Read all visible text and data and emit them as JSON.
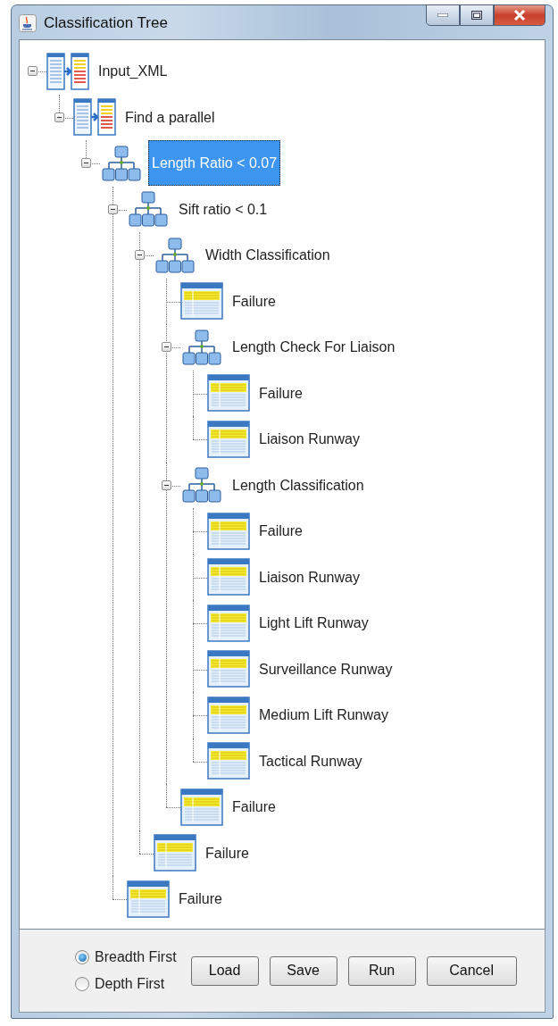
{
  "window": {
    "title": "Classification Tree"
  },
  "tree": [
    {
      "label": "Input_XML",
      "kind": "process",
      "expanded": true,
      "selected": false,
      "children": [
        {
          "label": "Find a parallel",
          "kind": "process",
          "expanded": true,
          "selected": false,
          "children": [
            {
              "label": "Length Ratio < 0.07",
              "kind": "split",
              "expanded": true,
              "selected": true,
              "children": [
                {
                  "label": "Sift ratio < 0.1",
                  "kind": "split",
                  "expanded": true,
                  "selected": false,
                  "children": [
                    {
                      "label": "Width Classification",
                      "kind": "split",
                      "expanded": true,
                      "selected": false,
                      "children": [
                        {
                          "label": "Failure",
                          "kind": "leaf",
                          "selected": false
                        },
                        {
                          "label": "Length Check For Liaison",
                          "kind": "split",
                          "expanded": true,
                          "selected": false,
                          "children": [
                            {
                              "label": "Failure",
                              "kind": "leaf",
                              "selected": false
                            },
                            {
                              "label": "Liaison Runway",
                              "kind": "leaf",
                              "selected": false
                            }
                          ]
                        },
                        {
                          "label": "Length Classification",
                          "kind": "split",
                          "expanded": true,
                          "selected": false,
                          "children": [
                            {
                              "label": "Failure",
                              "kind": "leaf",
                              "selected": false
                            },
                            {
                              "label": "Liaison Runway",
                              "kind": "leaf",
                              "selected": false
                            },
                            {
                              "label": "Light Lift Runway",
                              "kind": "leaf",
                              "selected": false
                            },
                            {
                              "label": "Surveillance Runway",
                              "kind": "leaf",
                              "selected": false
                            },
                            {
                              "label": "Medium Lift Runway",
                              "kind": "leaf",
                              "selected": false
                            },
                            {
                              "label": "Tactical Runway",
                              "kind": "leaf",
                              "selected": false
                            }
                          ]
                        },
                        {
                          "label": "Failure",
                          "kind": "leaf",
                          "selected": false
                        }
                      ]
                    },
                    {
                      "label": "Failure",
                      "kind": "leaf",
                      "selected": false
                    }
                  ]
                },
                {
                  "label": "Failure",
                  "kind": "leaf",
                  "selected": false
                }
              ]
            }
          ]
        }
      ]
    }
  ],
  "search_order": [
    {
      "label": "Breadth First",
      "selected": true
    },
    {
      "label": "Depth First",
      "selected": false
    }
  ],
  "buttons": [
    "Load",
    "Save",
    "Run",
    "Cancel"
  ]
}
